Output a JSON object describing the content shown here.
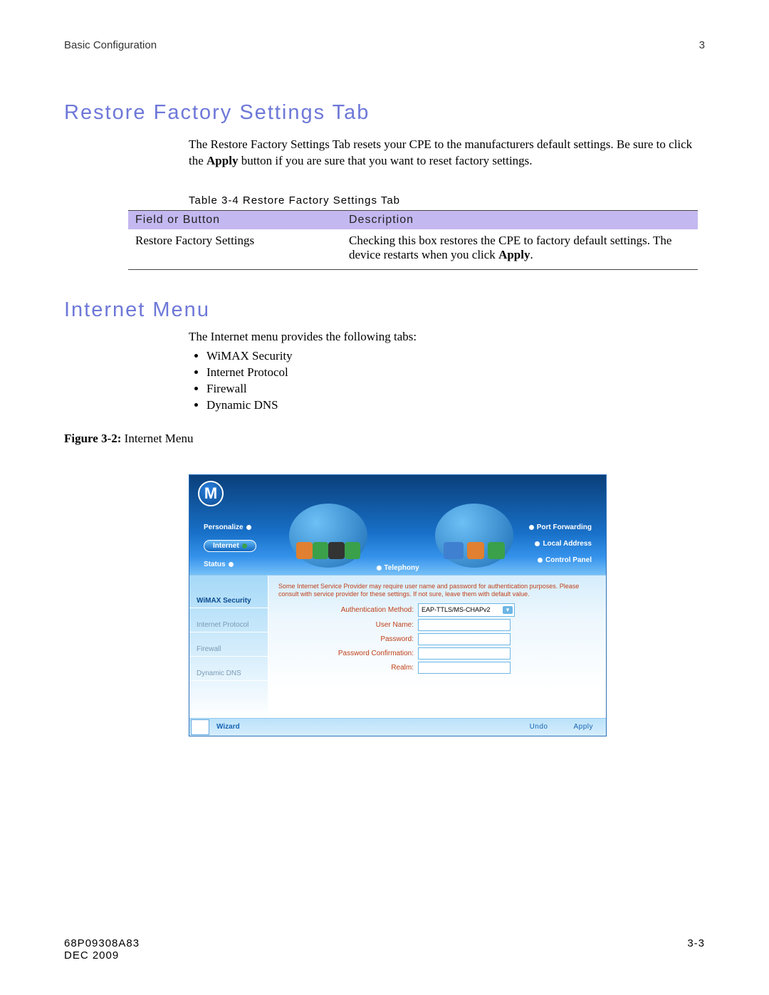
{
  "header": {
    "left": "Basic Configuration",
    "right": "3"
  },
  "section1": {
    "heading": "Restore Factory Settings Tab",
    "paragraph_a": "The Restore Factory Settings Tab resets your CPE to the manufacturers default settings. Be sure to click the ",
    "paragraph_bold": "Apply",
    "paragraph_b": " button if you are sure that you want to reset factory settings.",
    "table_caption": "Table 3-4 Restore Factory Settings Tab",
    "th1": "Field or Button",
    "th2": "Description",
    "td1": "Restore Factory Settings",
    "td2_a": "Checking this box restores the CPE to factory default settings. The device restarts when you click ",
    "td2_bold": "Apply",
    "td2_b": "."
  },
  "section2": {
    "heading": "Internet Menu",
    "intro": "The Internet menu provides the following tabs:",
    "bullets": [
      "WiMAX Security",
      "Internet Protocol",
      "Firewall",
      "Dynamic DNS"
    ],
    "figure_bold": "Figure 3-2:",
    "figure_text": " Internet Menu"
  },
  "screenshot": {
    "nav_left": [
      "Personalize",
      "Internet",
      "Status"
    ],
    "nav_right": [
      "Port Forwarding",
      "Local Address",
      "Control Panel"
    ],
    "nav_center": "Telephony",
    "side_tabs": [
      "WiMAX Security",
      "Internet Protocol",
      "Firewall",
      "Dynamic DNS"
    ],
    "notice": "Some Internet Service Provider may require user name and password for authentication purposes. Please consult with service provider for these settings. If not sure, leave them with default value.",
    "labels": {
      "auth": "Authentication Method:",
      "user": "User Name:",
      "pass": "Password:",
      "passc": "Password Confirmation:",
      "realm": "Realm:"
    },
    "auth_value": "EAP-TTLS/MS-CHAPv2",
    "wizard": "Wizard",
    "undo": "Undo",
    "apply": "Apply"
  },
  "footer": {
    "doc": "68P09308A83",
    "date": "DEC 2009",
    "page": "3-3"
  }
}
